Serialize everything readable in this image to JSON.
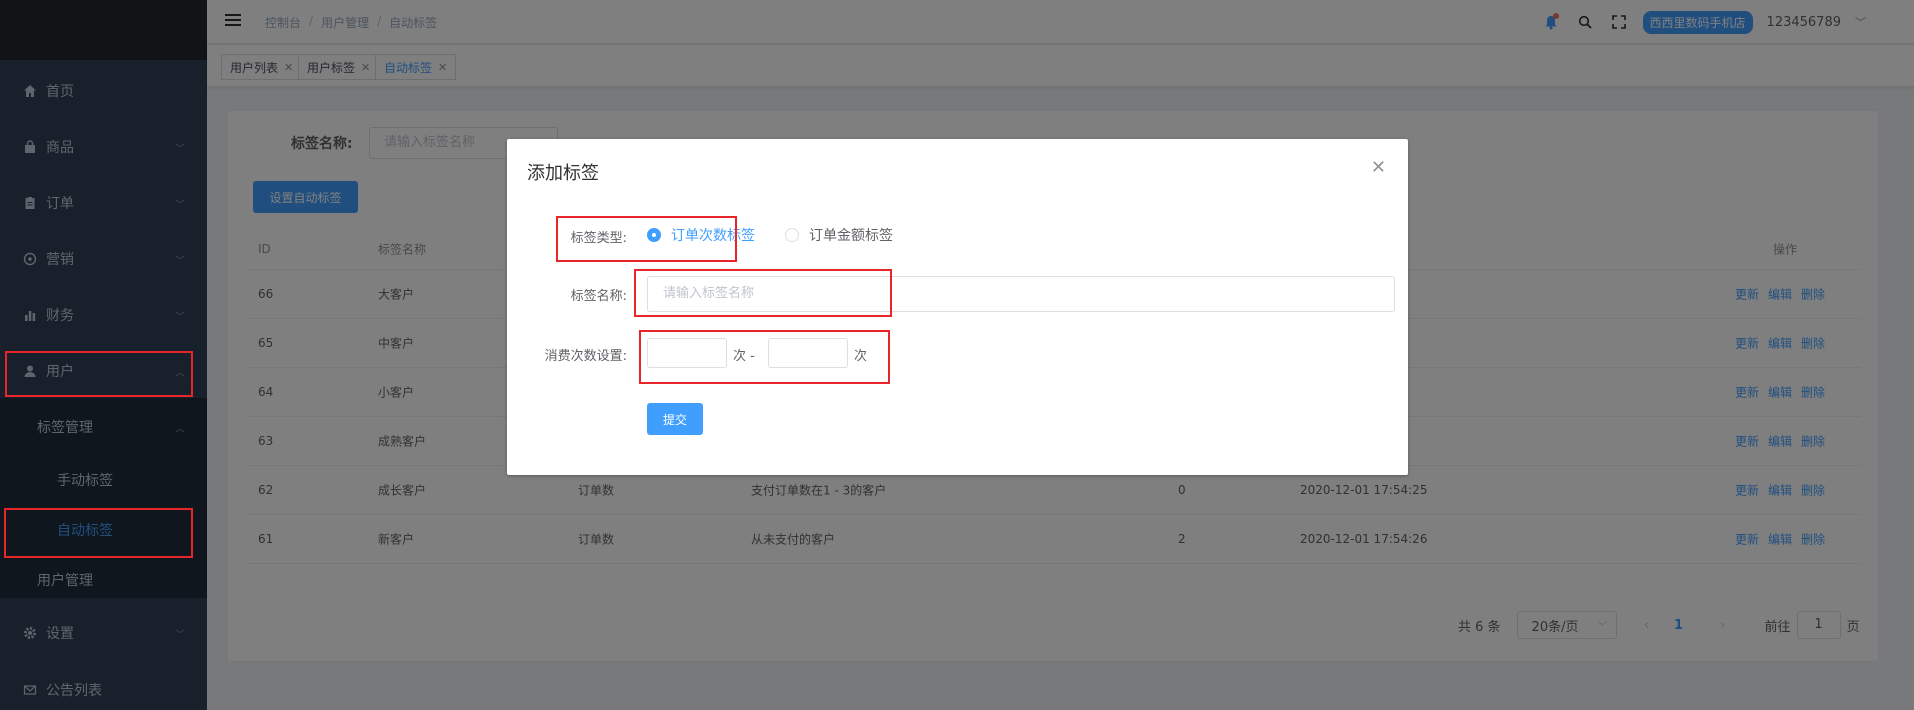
{
  "header": {
    "breadcrumb": [
      "控制台",
      "用户管理",
      "自动标签"
    ],
    "breadcrumb_sep": "/",
    "store_name": "西西里数码手机店",
    "username": "123456789"
  },
  "sidebar": {
    "items": [
      {
        "label": "首页",
        "icon": "home-icon"
      },
      {
        "label": "商品",
        "icon": "bag-icon"
      },
      {
        "label": "订单",
        "icon": "clipboard-icon"
      },
      {
        "label": "营销",
        "icon": "gift-icon"
      },
      {
        "label": "财务",
        "icon": "bar-chart-icon"
      },
      {
        "label": "用户",
        "icon": "user-icon"
      },
      {
        "label": "设置",
        "icon": "gear-icon"
      },
      {
        "label": "公告列表",
        "icon": "mail-icon"
      }
    ],
    "sub_group": "标签管理",
    "sub_items": [
      "手动标签",
      "自动标签"
    ],
    "sub_user_mgmt": "用户管理"
  },
  "tags": [
    {
      "label": "用户列表",
      "active": false
    },
    {
      "label": "用户标签",
      "active": false
    },
    {
      "label": "自动标签",
      "active": true
    }
  ],
  "filter": {
    "name_label": "标签名称:",
    "name_placeholder": "请输入标签名称",
    "set_button": "设置自动标签"
  },
  "table": {
    "headers": {
      "id": "ID",
      "name": "标签名称",
      "op": "操作"
    },
    "rows": [
      {
        "id": "66",
        "name": "大客户",
        "type": "",
        "desc": "",
        "count": "",
        "time": ""
      },
      {
        "id": "65",
        "name": "中客户",
        "type": "",
        "desc": "",
        "count": "",
        "time": ""
      },
      {
        "id": "64",
        "name": "小客户",
        "type": "",
        "desc": "",
        "count": "",
        "time": ""
      },
      {
        "id": "63",
        "name": "成熟客户",
        "type": "",
        "desc": "",
        "count": "",
        "time": ""
      },
      {
        "id": "62",
        "name": "成长客户",
        "type": "订单数",
        "desc": "支付订单数在1 - 3的客户",
        "count": "0",
        "time": "2020-12-01 17:54:25"
      },
      {
        "id": "61",
        "name": "新客户",
        "type": "订单数",
        "desc": "从未支付的客户",
        "count": "2",
        "time": "2020-12-01 17:54:26"
      }
    ],
    "ops": {
      "refresh": "更新",
      "edit": "编辑",
      "delete": "删除"
    }
  },
  "pagination": {
    "total": "共 6 条",
    "page_size": "20条/页",
    "current_page": "1",
    "goto_label": "前往",
    "goto_value": "1",
    "page_suffix": "页"
  },
  "dialog": {
    "title": "添加标签",
    "type_label": "标签类型:",
    "type_options": [
      {
        "label": "订单次数标签",
        "checked": true
      },
      {
        "label": "订单金额标签",
        "checked": false
      }
    ],
    "name_label": "标签名称:",
    "name_placeholder": "请输入标签名称",
    "count_label": "消费次数设置:",
    "unit_from": "次 -",
    "unit_to": "次",
    "submit": "提交"
  }
}
